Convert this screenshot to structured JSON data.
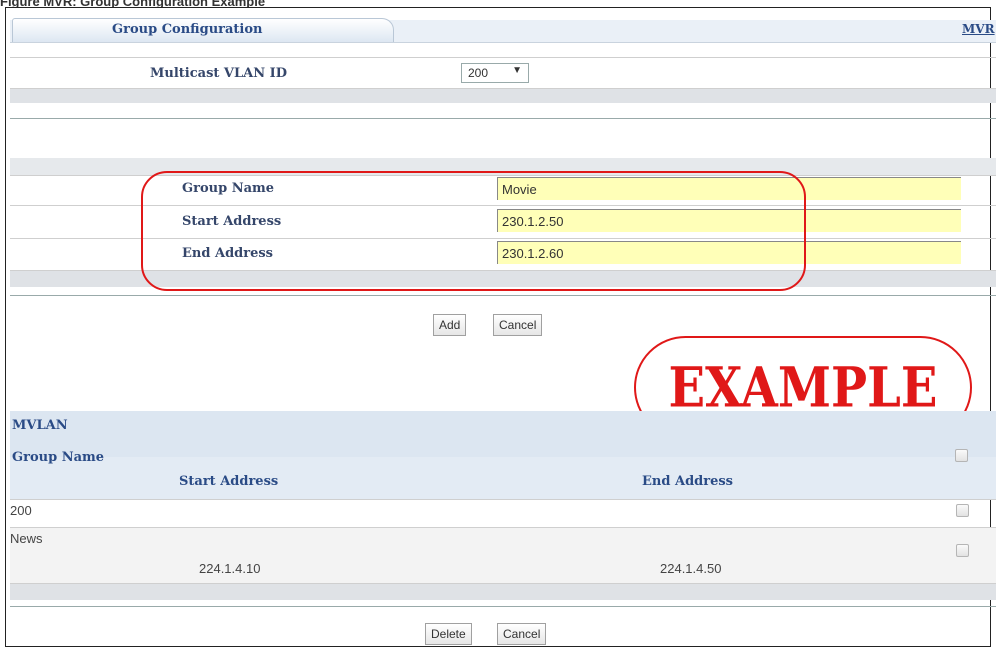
{
  "figure": {
    "caption": "Figure          MVR: Group Configuration Example"
  },
  "tabs": {
    "active": "Group Configuration",
    "link": "MVR"
  },
  "multicast": {
    "label": "Multicast VLAN ID",
    "selected": "200"
  },
  "form": {
    "group_name_label": "Group Name",
    "group_name_value": "Movie",
    "start_label": "Start Address",
    "start_value": "230.1.2.50",
    "end_label": "End Address",
    "end_value": "230.1.2.60"
  },
  "buttons": {
    "add": "Add",
    "cancel": "Cancel",
    "delete": "Delete",
    "cancel2": "Cancel"
  },
  "stamp": {
    "text": "EXAMPLE",
    "color": "#e01818"
  },
  "table": {
    "mvlan_header": "MVLAN",
    "group_header": "Group Name",
    "start_header": "Start Address",
    "end_header": "End Address",
    "rows": [
      {
        "mvlan": "200"
      },
      {
        "group": "News",
        "start": "224.1.4.10",
        "end": "224.1.4.50"
      }
    ]
  },
  "colors": {
    "input_bg": "#ffffb8",
    "header_text": "#2a4b86",
    "callout": "#e01818"
  }
}
